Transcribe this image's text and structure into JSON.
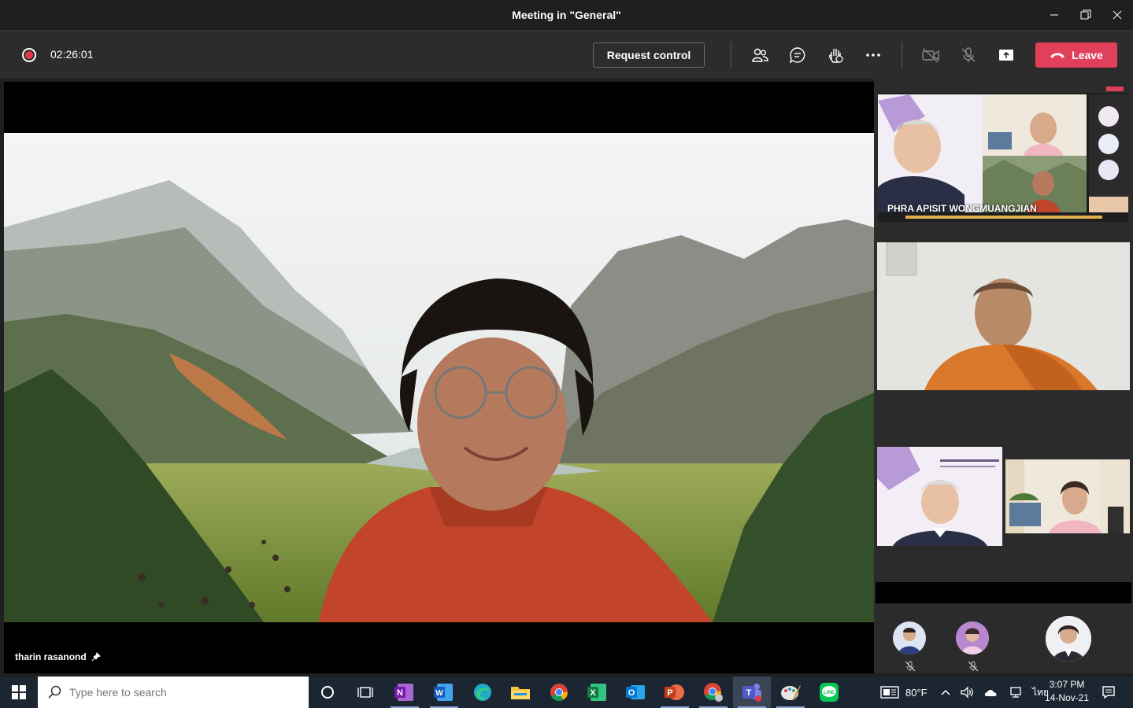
{
  "window": {
    "title": "Meeting in \"General\""
  },
  "toolbar": {
    "timer": "02:26:01",
    "request_control_label": "Request control",
    "leave_label": "Leave"
  },
  "stage": {
    "speaker_name": "tharin rasanond"
  },
  "panel": {
    "share_label": "PHRA APISIT WONGMUANGJIAN"
  },
  "taskbar": {
    "search_placeholder": "Type here to search",
    "weather": "80°F",
    "lang": "ไทย",
    "time": "3:07 PM",
    "date": "14-Nov-21"
  },
  "colors": {
    "leave": "#e0405a",
    "record": "#e03a48",
    "taskbar": "#1c2633"
  }
}
